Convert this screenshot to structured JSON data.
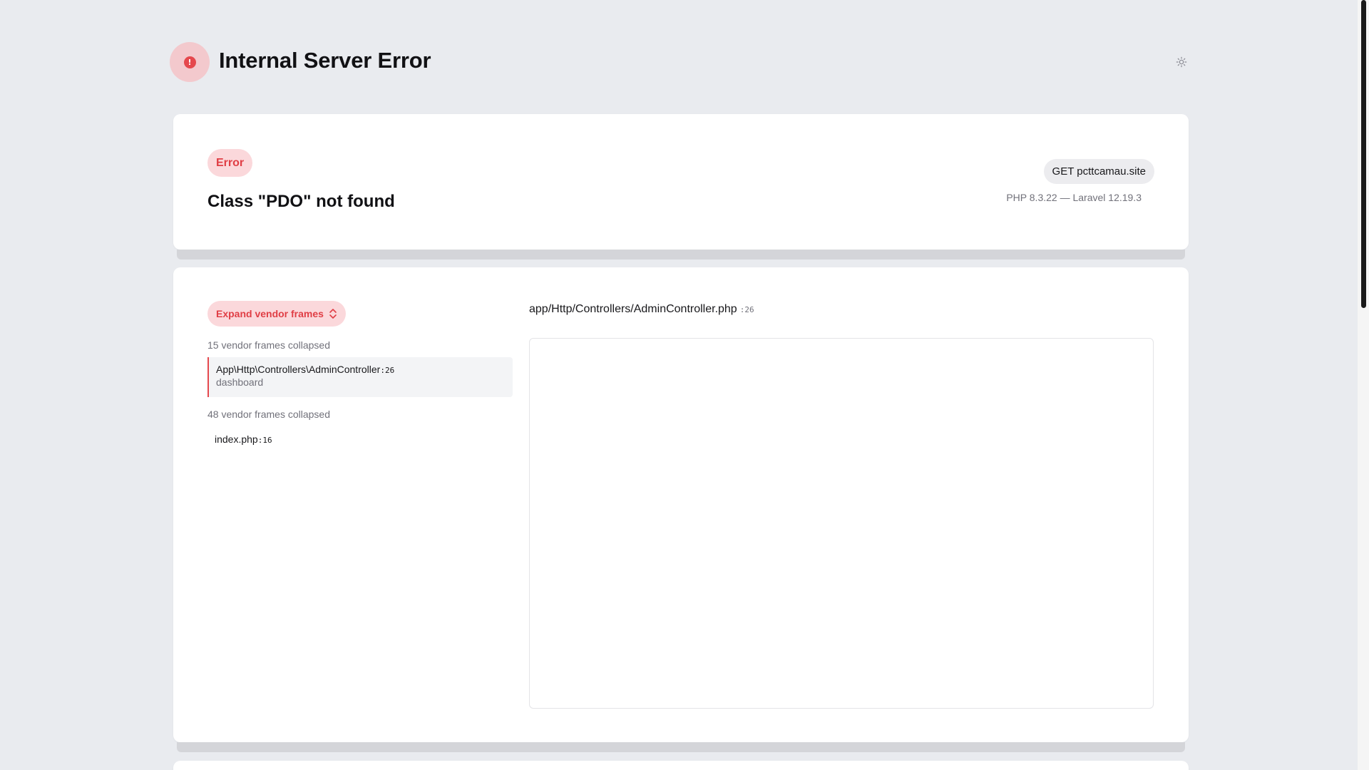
{
  "header": {
    "title": "Internal Server Error",
    "error_icon": "exclamation-circle-icon",
    "theme_icon": "sun-icon"
  },
  "summary": {
    "badge": "Error",
    "message": "Class \"PDO\" not found",
    "request": "GET pcttcamau.site",
    "versions": "PHP 8.3.22 — Laravel 12.19.3"
  },
  "trace": {
    "expand_label": "Expand vendor frames",
    "expand_icon": "chevron-up-down-icon",
    "collapsed_top": "15 vendor frames collapsed",
    "active_frame": {
      "class": "App\\Http\\Controllers\\AdminController",
      "line": ":26",
      "method": "dashboard"
    },
    "collapsed_bottom": "48 vendor frames collapsed",
    "plain_frame": {
      "file": "index.php",
      "line": ":16"
    },
    "file_path": "app/Http/Controllers/AdminController.php",
    "file_line": ":26"
  },
  "colors": {
    "background": "#e9ebef",
    "accent_red": "#e5484d",
    "badge_bg": "#fbd8db"
  }
}
